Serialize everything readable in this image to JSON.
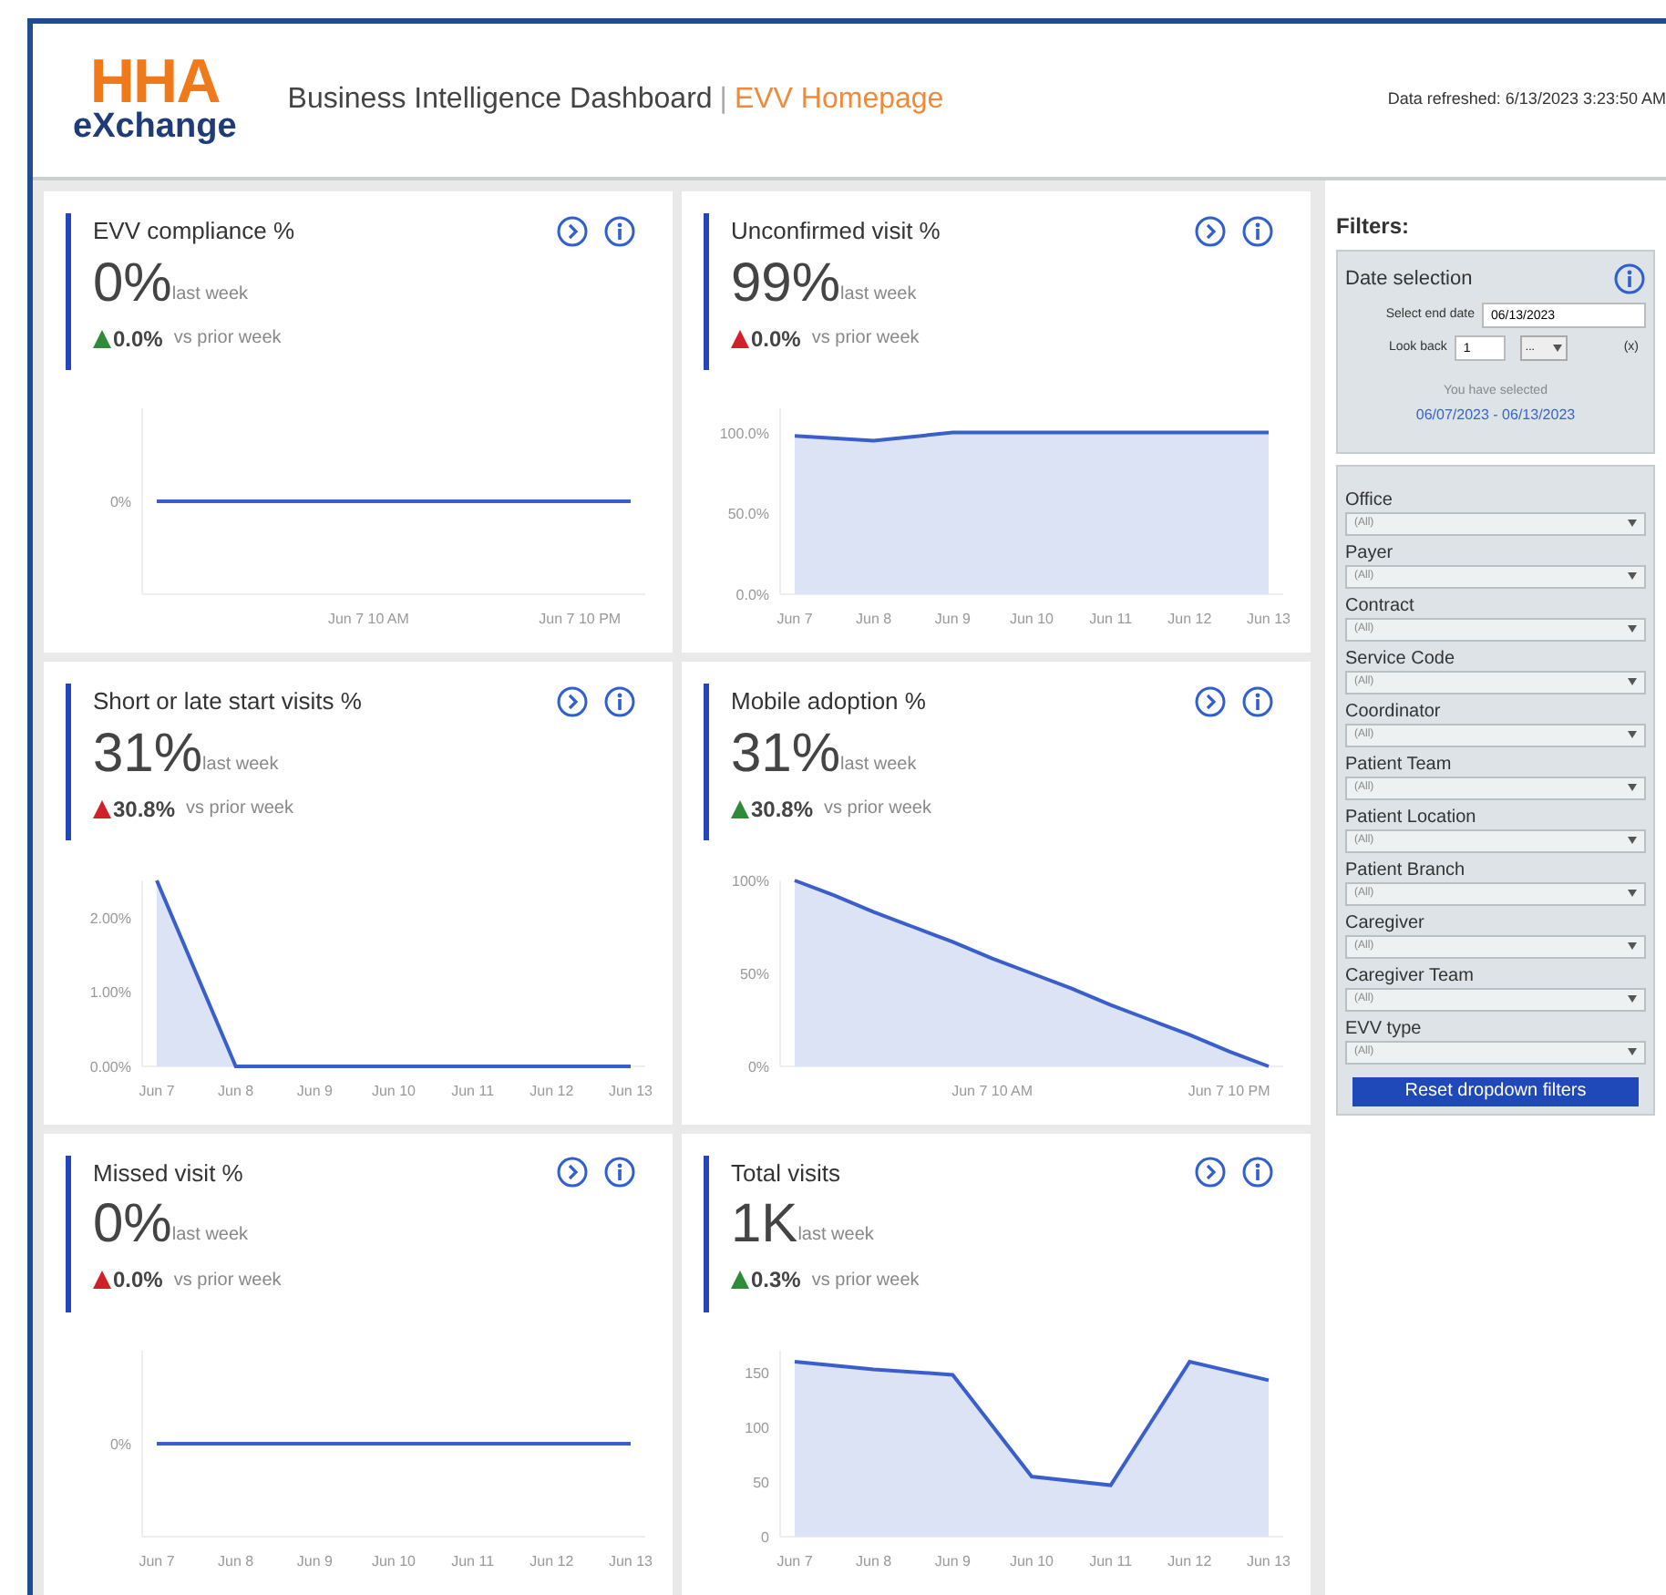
{
  "header": {
    "logo_top": "HHA",
    "logo_bottom": "eXchange",
    "title": "Business Intelligence Dashboard",
    "separator": "|",
    "subtitle": "EVV Homepage",
    "refreshed": "Data refreshed: 6/13/2023 3:23:50 AM"
  },
  "cards": [
    {
      "title": "EVV compliance %",
      "value": "0%",
      "period": "last week",
      "delta": "0.0%",
      "color": "#2e8b3a",
      "comparison": "vs prior week",
      "trend": {
        "y_label": "0%",
        "x_labels": [
          "Jun 7 10 AM",
          "Jun 7 10 PM"
        ]
      }
    },
    {
      "title": "Unconfirmed visit %",
      "value": "99%",
      "period": "last week",
      "delta": "0.0%",
      "color": "#d0202a",
      "comparison": "vs prior week",
      "chart_data": {
        "type": "area",
        "categories": [
          "Jun 7",
          "Jun 8",
          "Jun 9",
          "Jun 10",
          "Jun 11",
          "Jun 12",
          "Jun 13"
        ],
        "values": [
          98,
          95,
          100,
          100,
          100,
          100,
          100
        ],
        "ylim": [
          0,
          115
        ],
        "yticks": [
          {
            "value": 0,
            "label": "0.0%"
          },
          {
            "value": 50,
            "label": "50.0%"
          },
          {
            "value": 100,
            "label": "100.0%"
          }
        ]
      }
    },
    {
      "title": "Short or late start visits %",
      "value": "31%",
      "period": "last week",
      "delta": "30.8%",
      "color": "#d0202a",
      "comparison": "vs prior week",
      "chart_data": {
        "type": "area",
        "categories": [
          "Jun 7",
          "Jun 8",
          "Jun 9",
          "Jun 10",
          "Jun 11",
          "Jun 12",
          "Jun 13"
        ],
        "values": [
          2.5,
          0,
          0,
          0,
          0,
          0,
          0
        ],
        "ylim": [
          0,
          2.5
        ],
        "yticks": [
          {
            "value": 0,
            "label": "0.00%"
          },
          {
            "value": 1,
            "label": "1.00%"
          },
          {
            "value": 2,
            "label": "2.00%"
          }
        ]
      }
    },
    {
      "title": "Mobile adoption %",
      "value": "31%",
      "period": "last week",
      "delta": "30.8%",
      "color": "#2e8b3a",
      "comparison": "vs prior week",
      "chart_data": {
        "type": "area",
        "categories": [
          null,
          null,
          null,
          null,
          null,
          "Jun 7 10 AM",
          null,
          null,
          null,
          null,
          null,
          "Jun 7 10 PM",
          null
        ],
        "values": [
          100,
          92,
          83,
          75,
          67,
          58,
          50,
          42,
          33,
          25,
          17,
          8,
          0
        ],
        "ylim": [
          0,
          100
        ],
        "yticks": [
          {
            "value": 0,
            "label": "0%"
          },
          {
            "value": 50,
            "label": "50%"
          },
          {
            "value": 100,
            "label": "100%"
          }
        ]
      }
    },
    {
      "title": "Missed visit %",
      "value": "0%",
      "period": "last week",
      "delta": "0.0%",
      "color": "#d0202a",
      "comparison": "vs prior week",
      "trend": {
        "y_label": "0%",
        "x_labels": [
          "Jun 7",
          "Jun 8",
          "Jun 9",
          "Jun 10",
          "Jun 11",
          "Jun 12",
          "Jun 13"
        ]
      }
    },
    {
      "title": "Total visits",
      "value": "1K",
      "period": "last week",
      "delta": "0.3%",
      "color": "#2e8b3a",
      "comparison": "vs prior week",
      "chart_data": {
        "type": "area",
        "categories": [
          "Jun 7",
          "Jun 8",
          "Jun 9",
          "Jun 10",
          "Jun 11",
          "Jun 12",
          "Jun 13"
        ],
        "values": [
          160,
          153,
          148,
          55,
          47,
          160,
          143
        ],
        "ylim": [
          0,
          170
        ],
        "yticks": [
          {
            "value": 0,
            "label": "0"
          },
          {
            "value": 50,
            "label": "50"
          },
          {
            "value": 100,
            "label": "100"
          },
          {
            "value": 150,
            "label": "150"
          }
        ]
      }
    }
  ],
  "filters": {
    "title": "Filters:",
    "date_selection": {
      "title": "Date selection",
      "end_date_label": "Select end date",
      "end_date": "06/13/2023",
      "look_back_label": "Look back",
      "look_back": "1",
      "unit": "...",
      "clear": "(x)",
      "selected_label": "You have selected",
      "selected_range": "06/07/2023 - 06/13/2023"
    },
    "dropdowns": [
      {
        "label": "Office",
        "value": "(All)"
      },
      {
        "label": "Payer",
        "value": "(All)"
      },
      {
        "label": "Contract",
        "value": "(All)"
      },
      {
        "label": "Service Code",
        "value": "(All)"
      },
      {
        "label": "Coordinator",
        "value": "(All)"
      },
      {
        "label": "Patient Team",
        "value": "(All)"
      },
      {
        "label": "Patient Location",
        "value": "(All)"
      },
      {
        "label": "Patient Branch",
        "value": "(All)"
      },
      {
        "label": "Caregiver",
        "value": "(All)"
      },
      {
        "label": "Caregiver Team",
        "value": "(All)"
      },
      {
        "label": "EVV type",
        "value": "(All)"
      }
    ],
    "reset_button": "Reset dropdown filters"
  }
}
